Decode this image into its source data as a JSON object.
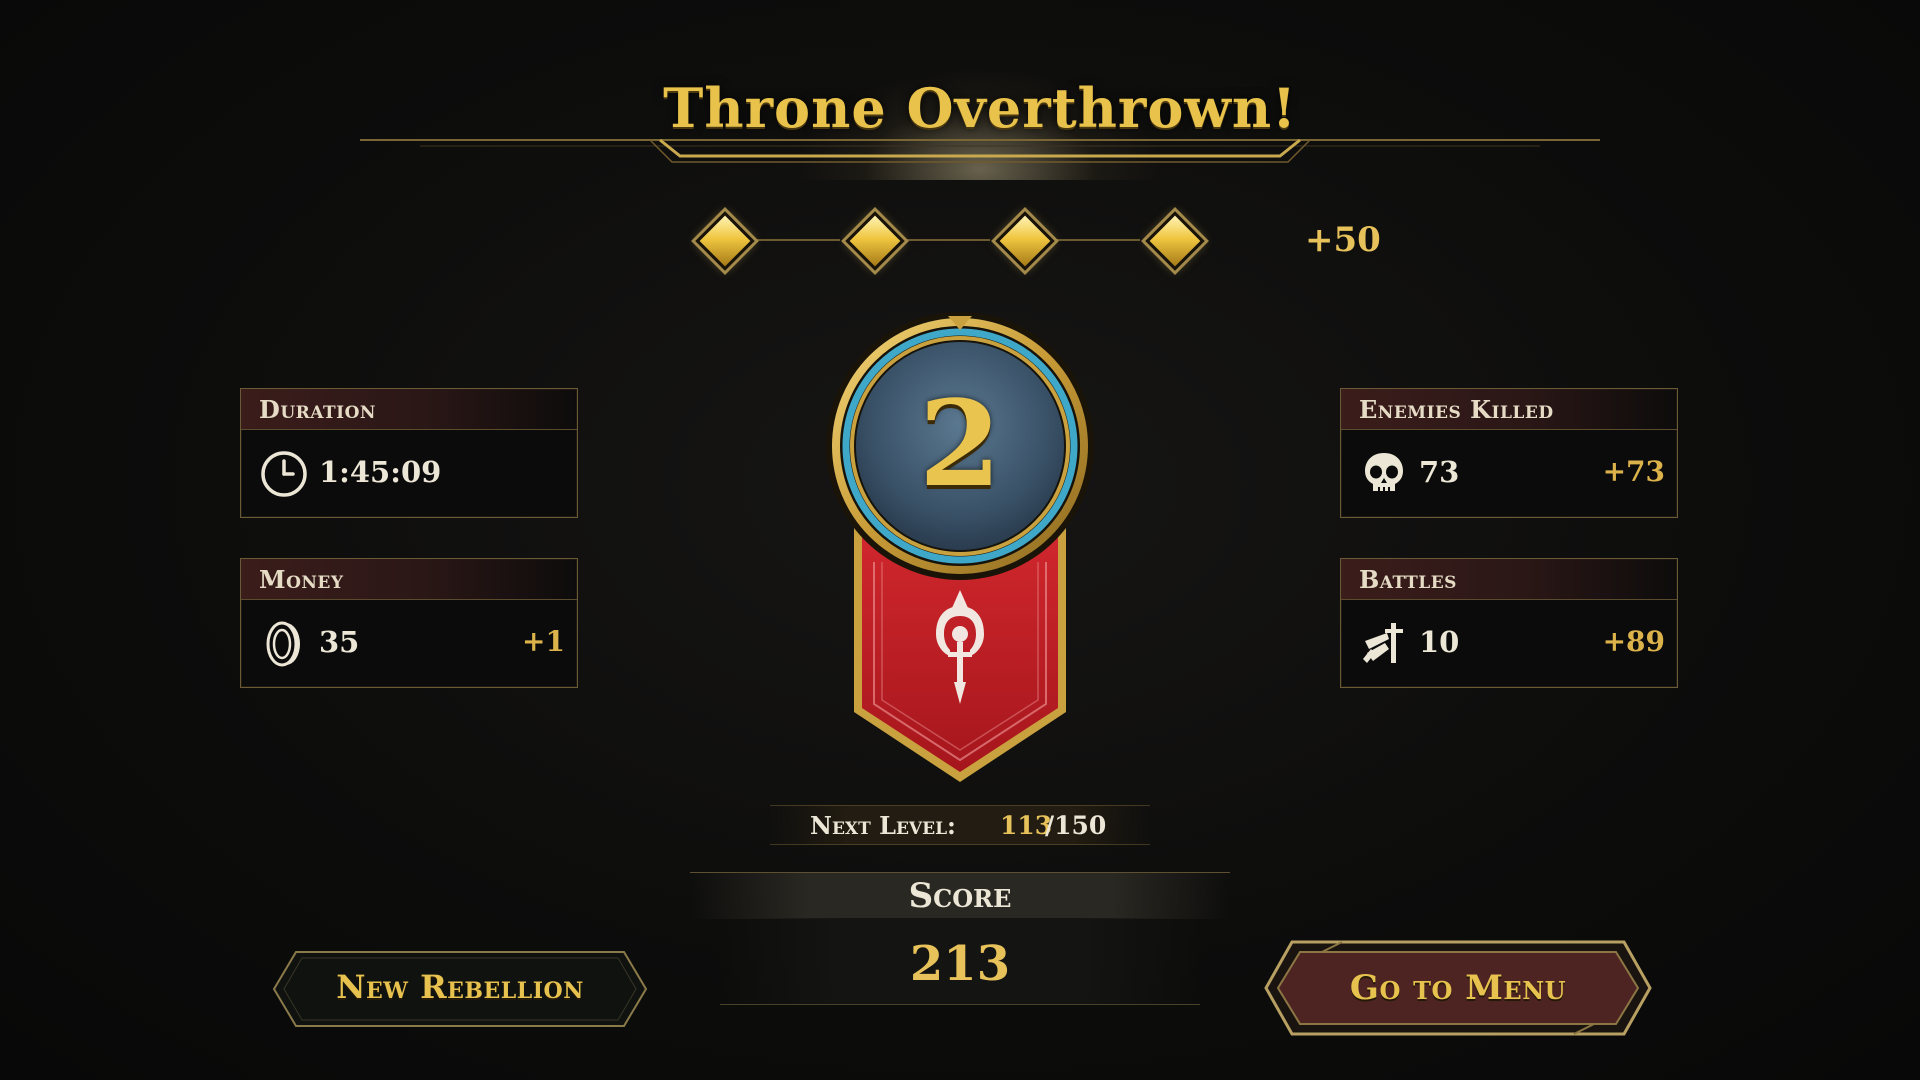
{
  "title": "Throne Overthrown!",
  "progress": {
    "diamonds_filled": 4,
    "diamonds_total": 4,
    "bonus": "+50"
  },
  "stats": {
    "duration": {
      "title": "Duration",
      "value": "1:45:09",
      "icon": "clock-icon"
    },
    "money": {
      "title": "Money",
      "value": "35",
      "bonus": "+1",
      "icon": "coin-icon"
    },
    "enemies_killed": {
      "title": "Enemies Killed",
      "value": "73",
      "bonus": "+73",
      "icon": "skull-icon"
    },
    "battles": {
      "title": "Battles",
      "value": "10",
      "bonus": "+89",
      "icon": "crossed-swords-icon"
    }
  },
  "level": {
    "number": "2",
    "emblem": "dagger-emblem-icon"
  },
  "next_level": {
    "label": "Next Level:",
    "current": "113",
    "separator_total": "/150",
    "progress_fraction": 0.753
  },
  "score": {
    "label": "Score",
    "value": "213"
  },
  "buttons": {
    "new_rebellion": "New Rebellion",
    "go_to_menu": "Go to Menu"
  },
  "colors": {
    "gold": "#e7c25a",
    "banner_red": "#c8242c",
    "medal_blue": "#3c5670",
    "ring_cyan": "#3fa8c8"
  }
}
